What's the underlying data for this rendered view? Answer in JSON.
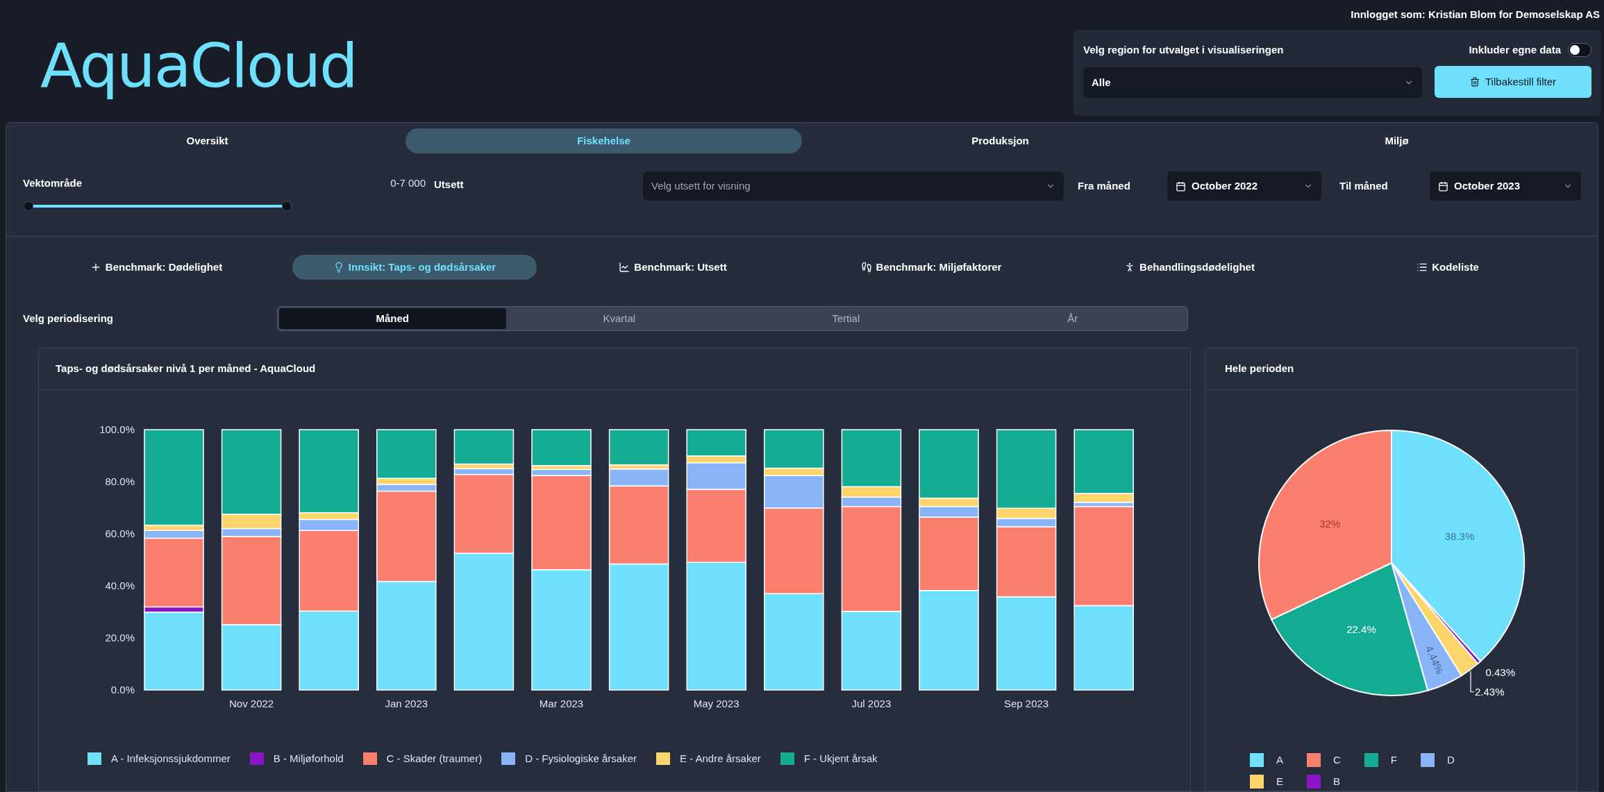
{
  "header": {
    "logo": "AquaCloud",
    "login": "Innlogget som: Kristian Blom for Demoselskap AS",
    "region": {
      "label": "Velg region for utvalget i visualiseringen",
      "value": "Alle"
    },
    "own_data": {
      "label": "Inkluder egne data",
      "on": false
    },
    "reset_button": "Tilbakestill filter"
  },
  "tabs": [
    {
      "label": "Oversikt",
      "selected": false
    },
    {
      "label": "Fiskehelse",
      "selected": true
    },
    {
      "label": "Produksjon",
      "selected": false
    },
    {
      "label": "Miljø",
      "selected": false
    }
  ],
  "filters": {
    "weight": {
      "label": "Vektområde",
      "reading": "0-7 000",
      "level": 0.98
    },
    "release": {
      "label": "Utsett",
      "placeholder": "Velg utsett for visning"
    },
    "from_month": {
      "label": "Fra måned",
      "value": "October 2022"
    },
    "to_month": {
      "label": "Til måned",
      "value": "October 2023"
    }
  },
  "subtabs": [
    {
      "label": "Benchmark: Dødelighet",
      "selected": false
    },
    {
      "label": "Innsikt: Taps- og dødsårsaker",
      "selected": true
    },
    {
      "label": "Benchmark: Utsett",
      "selected": false
    },
    {
      "label": "Benchmark: Miljøfaktorer",
      "selected": false
    },
    {
      "label": "Behandlingsdødelighet",
      "selected": false
    },
    {
      "label": "Kodeliste",
      "selected": false
    }
  ],
  "periodisering": {
    "label": "Velg periodisering",
    "options": [
      {
        "label": "Måned",
        "selected": true
      },
      {
        "label": "Kvartal",
        "selected": false
      },
      {
        "label": "Tertial",
        "selected": false
      },
      {
        "label": "År",
        "selected": false
      }
    ]
  },
  "bar_card": {
    "title": "Taps- og dødsårsaker nivå 1 per måned - AquaCloud",
    "chart_data": {
      "type": "bar",
      "stacked": true,
      "categories": [
        null,
        "Nov 2022",
        null,
        "Jan 2023",
        null,
        "Mar 2023",
        null,
        "May 2023",
        null,
        "Jul 2023",
        null,
        "Sep 2023",
        null
      ],
      "ylim": [
        0,
        1
      ],
      "yticks": [
        {
          "value": 0,
          "label": "0.0%"
        },
        {
          "value": 0.2,
          "label": "20.0%"
        },
        {
          "value": 0.4,
          "label": "40.0%"
        },
        {
          "value": 0.6,
          "label": "60.0%"
        },
        {
          "value": 0.8,
          "label": "80.0%"
        },
        {
          "value": 1,
          "label": "100.0%"
        }
      ],
      "series": [
        {
          "name": "A - Infeksjonssjukdommer",
          "color": "#6ee0fb",
          "values": [
            0.299,
            0.251,
            0.303,
            0.417,
            0.525,
            0.462,
            0.484,
            0.49,
            0.37,
            0.302,
            0.382,
            0.358,
            0.324
          ]
        },
        {
          "name": "B - Miljøforhold",
          "color": "#8a14c8",
          "values": [
            0.02,
            0,
            0,
            0,
            0,
            0,
            0,
            0,
            0,
            0,
            0,
            0,
            0
          ]
        },
        {
          "name": "C - Skader (traumer)",
          "color": "#fa7f6e",
          "values": [
            0.264,
            0.339,
            0.31,
            0.347,
            0.303,
            0.362,
            0.3,
            0.281,
            0.329,
            0.403,
            0.282,
            0.269,
            0.381
          ]
        },
        {
          "name": "D - Fysiologiske årsaker",
          "color": "#8ab4f8",
          "values": [
            0.03,
            0.03,
            0.042,
            0.026,
            0.022,
            0.023,
            0.065,
            0.102,
            0.125,
            0.036,
            0.041,
            0.032,
            0.016
          ]
        },
        {
          "name": "E - Andre årsaker",
          "color": "#fbd46a",
          "values": [
            0.02,
            0.055,
            0.026,
            0.023,
            0.018,
            0.015,
            0.016,
            0.026,
            0.028,
            0.04,
            0.032,
            0.039,
            0.034
          ]
        },
        {
          "name": "F - Ukjent årsak",
          "color": "#13ac93",
          "values": [
            0.367,
            0.325,
            0.319,
            0.187,
            0.132,
            0.138,
            0.135,
            0.101,
            0.148,
            0.219,
            0.263,
            0.302,
            0.245
          ]
        }
      ]
    }
  },
  "pie_card": {
    "title": "Hele perioden",
    "chart_data": {
      "type": "pie",
      "categories": [
        "A",
        "C",
        "F",
        "D",
        "E",
        "B"
      ],
      "values": [
        38.3,
        32,
        22.4,
        4.44,
        2.43,
        0.43
      ],
      "colors": [
        "#6ee0fb",
        "#fa7f6e",
        "#13ac93",
        "#8ab4f8",
        "#fbd46a",
        "#8a14c8"
      ],
      "value_labels": [
        "38.3%",
        "32%",
        "22.4%",
        "4.44%",
        "2.43%",
        "0.43%"
      ]
    }
  }
}
